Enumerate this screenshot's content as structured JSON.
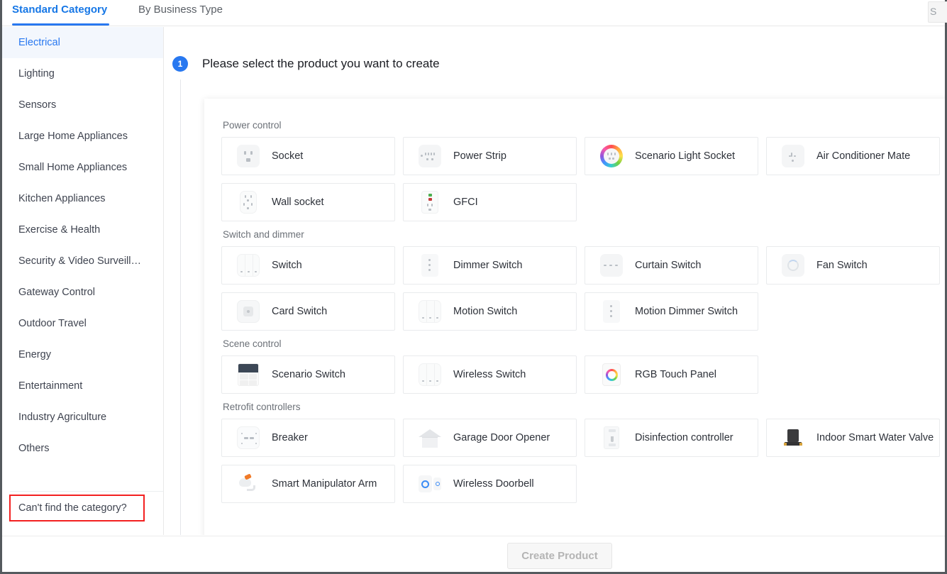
{
  "tabs": [
    {
      "label": "Standard Category",
      "active": true
    },
    {
      "label": "By Business Type",
      "active": false
    }
  ],
  "search": {
    "partial_label": "S"
  },
  "sidebar": {
    "items": [
      {
        "label": "Electrical",
        "active": true
      },
      {
        "label": "Lighting",
        "active": false
      },
      {
        "label": "Sensors",
        "active": false
      },
      {
        "label": "Large Home Appliances",
        "active": false
      },
      {
        "label": "Small Home Appliances",
        "active": false
      },
      {
        "label": "Kitchen Appliances",
        "active": false
      },
      {
        "label": "Exercise & Health",
        "active": false
      },
      {
        "label": "Security & Video Surveill…",
        "active": false
      },
      {
        "label": "Gateway Control",
        "active": false
      },
      {
        "label": "Outdoor Travel",
        "active": false
      },
      {
        "label": "Energy",
        "active": false
      },
      {
        "label": "Entertainment",
        "active": false
      },
      {
        "label": "Industry Agriculture",
        "active": false
      },
      {
        "label": "Others",
        "active": false
      }
    ],
    "footer_link": "Can't find the category?"
  },
  "step": {
    "number": "1",
    "title": "Please select the product you want to create"
  },
  "groups": [
    {
      "title": "Power control",
      "products": [
        {
          "label": "Socket",
          "icon": "socket-icon"
        },
        {
          "label": "Power Strip",
          "icon": "power-strip-icon"
        },
        {
          "label": "Scenario Light Socket",
          "icon": "scenario-light-socket-icon"
        },
        {
          "label": "Air Conditioner Mate",
          "icon": "air-conditioner-mate-icon"
        },
        {
          "label": "Wall socket",
          "icon": "wall-socket-icon"
        },
        {
          "label": "GFCI",
          "icon": "gfci-icon"
        }
      ]
    },
    {
      "title": "Switch and dimmer",
      "products": [
        {
          "label": "Switch",
          "icon": "switch-icon"
        },
        {
          "label": "Dimmer Switch",
          "icon": "dimmer-switch-icon"
        },
        {
          "label": "Curtain Switch",
          "icon": "curtain-switch-icon"
        },
        {
          "label": "Fan Switch",
          "icon": "fan-switch-icon"
        },
        {
          "label": "Card Switch",
          "icon": "card-switch-icon"
        },
        {
          "label": "Motion Switch",
          "icon": "motion-switch-icon"
        },
        {
          "label": "Motion Dimmer Switch",
          "icon": "motion-dimmer-switch-icon"
        }
      ]
    },
    {
      "title": "Scene control",
      "products": [
        {
          "label": "Scenario Switch",
          "icon": "scenario-switch-icon"
        },
        {
          "label": "Wireless Switch",
          "icon": "wireless-switch-icon"
        },
        {
          "label": "RGB Touch Panel",
          "icon": "rgb-touch-panel-icon"
        }
      ]
    },
    {
      "title": "Retrofit controllers",
      "products": [
        {
          "label": "Breaker",
          "icon": "breaker-icon"
        },
        {
          "label": "Garage Door Opener",
          "icon": "garage-door-opener-icon"
        },
        {
          "label": "Disinfection controller",
          "icon": "disinfection-controller-icon"
        },
        {
          "label": "Indoor Smart Water Valve",
          "icon": "indoor-smart-water-valve-icon"
        },
        {
          "label": "Smart Manipulator Arm",
          "icon": "smart-manipulator-arm-icon"
        },
        {
          "label": "Wireless Doorbell",
          "icon": "wireless-doorbell-icon"
        }
      ]
    }
  ],
  "footer": {
    "create_button": "Create Product"
  },
  "colors": {
    "accent": "#2878f0",
    "active_sidebar_bg": "#f3f7fd",
    "highlight_outline": "#f32020",
    "text_primary": "#2d3139",
    "text_muted": "#6b7077"
  }
}
